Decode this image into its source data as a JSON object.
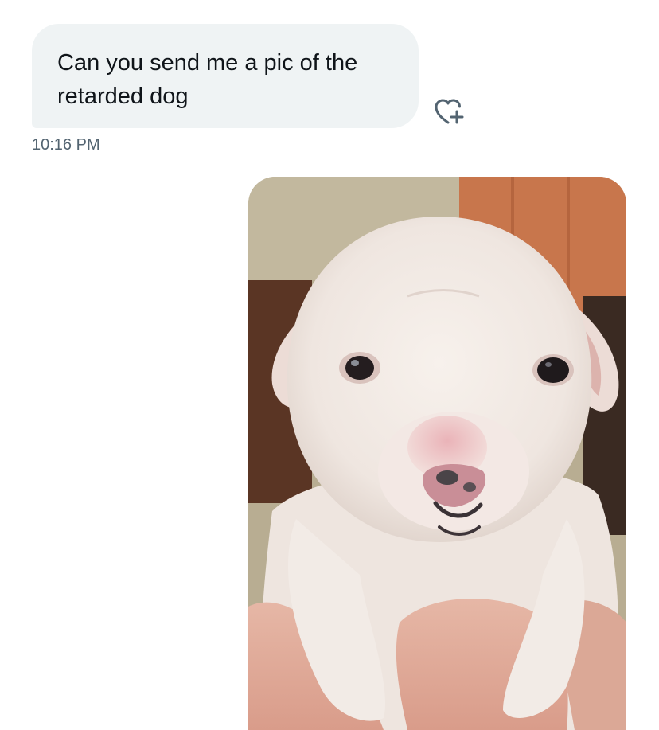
{
  "incoming_message": {
    "text": "Can you send me a pic of the retarded dog",
    "line1": "Can you send me a pic of the",
    "line2": "retarded dog",
    "timestamp": "10:16 PM"
  },
  "reaction": {
    "icon": "heart-plus-icon"
  },
  "outgoing_message": {
    "media_type": "image",
    "media_subject": "white puppy held in hands"
  },
  "colors": {
    "bubble_bg": "#eff3f4",
    "text": "#0f1419",
    "secondary_text": "#536471"
  }
}
